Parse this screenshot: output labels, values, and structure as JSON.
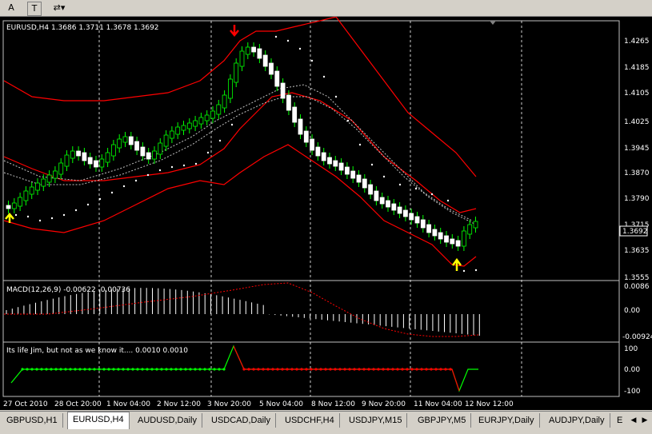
{
  "toolbar": {
    "items": [
      {
        "label": "A",
        "icon": "text-icon"
      },
      {
        "label": "T",
        "icon": "text-label-icon"
      },
      {
        "label": "⇄▾",
        "icon": "arrows-dropdown-icon"
      }
    ]
  },
  "chart": {
    "symbol_info": "EURUSD,H4  1.3686 1.3711 1.3678 1.3692",
    "price_labels": [
      "1.4265",
      "1.4185",
      "1.4105",
      "1.4025",
      "1.3945",
      "1.3870",
      "1.3790",
      "1.3715",
      "1.3635",
      "1.3555"
    ],
    "current_price": "1.3692",
    "macd_label": "MACD(12,26,9) -0.00622 -0.00736",
    "macd_scale": [
      "0.0086",
      "0.00",
      "-0.00924"
    ],
    "custom_label": "Its life Jim, but not as we know it....  0.0010 0.0010",
    "custom_scale": [
      "100",
      "0.00",
      "-100"
    ],
    "time_labels": [
      "27 Oct 2010",
      "28 Oct 20:00",
      "1 Nov 04:00",
      "2 Nov 12:00",
      "3 Nov 20:00",
      "5 Nov 04:00",
      "8 Nov 12:00",
      "9 Nov 20:00",
      "11 Nov 04:00",
      "12 Nov 12:00"
    ],
    "colors": {
      "bull": "#ffffff",
      "bear": "#ffffff",
      "wick": "#00ff00",
      "band": "#ff0000",
      "up_arrow": "#ffff00",
      "down_arrow": "#ff0000",
      "green_line": "#00ff00",
      "red_line": "#ff0000"
    }
  },
  "tabs": [
    "GBPUSD,H1",
    "EURUSD,H4",
    "AUDUSD,Daily",
    "USDCAD,Daily",
    "USDCHF,H4",
    "USDJPY,M15",
    "GBPJPY,M5",
    "EURJPY,Daily",
    "AUDJPY,Daily",
    "E"
  ],
  "active_tab": "EURUSD,H4"
}
